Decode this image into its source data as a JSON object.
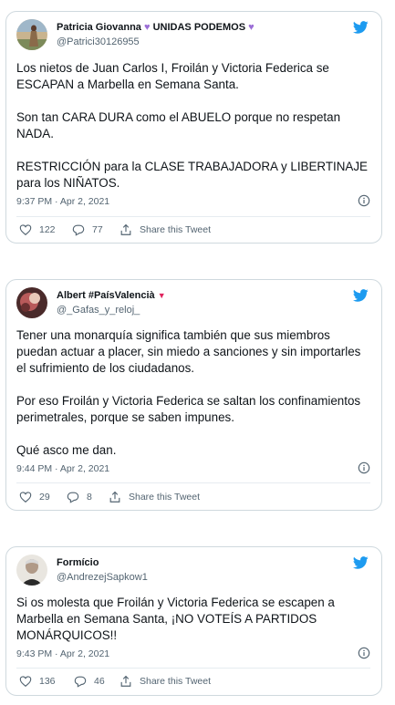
{
  "tweets": [
    {
      "name": "Patricia Giovanna",
      "name_suffix": "UNIDAS PODEMOS",
      "handle": "@Patrici30126955",
      "text": "Los nietos de Juan Carlos I, Froilán y Victoria Federica se ESCAPAN a Marbella en Semana Santa.\n\nSon tan CARA DURA como el ABUELO porque no respetan NADA.\n\nRESTRICCIÓN para la CLASE TRABAJADORA y LIBERTINAJE para los NIÑATOS.",
      "timestamp": "9:37 PM · Apr 2, 2021",
      "likes": "122",
      "replies": "77",
      "share_label": "Share this Tweet",
      "avatar_icon": "person-photo-avatar",
      "heart_color": "#9b6ed6"
    },
    {
      "name": "Albert #PaísValencià",
      "name_suffix": "",
      "handle": "@_Gafas_y_reloj_",
      "text": "Tener una monarquía significa también que sus miembros puedan actuar a placer, sin miedo a sanciones y sin importarles el sufrimiento de los ciudadanos.\n\nPor eso Froilán y Victoria Federica se saltan los confinamientos perimetrales, porque se saben impunes.\n\nQué asco me dan.",
      "timestamp": "9:44 PM · Apr 2, 2021",
      "likes": "29",
      "replies": "8",
      "share_label": "Share this Tweet",
      "avatar_icon": "flower-photo-avatar",
      "flag_color": "#e0245e"
    },
    {
      "name": "Formício",
      "name_suffix": "",
      "handle": "@AndrezejSapkow1",
      "text": "Si os molesta que Froilán y Victoria Federica se escapen a Marbella en Semana Santa, ¡NO VOTEÍS A PARTIDOS MONÁRQUICOS!!",
      "timestamp": "9:43 PM · Apr 2, 2021",
      "likes": "136",
      "replies": "46",
      "share_label": "Share this Tweet",
      "avatar_icon": "man-portrait-avatar"
    }
  ],
  "colors": {
    "twitter_blue": "#1d9bf0",
    "muted_text": "#536471",
    "border": "#cfd9de"
  },
  "icons": [
    "twitter-bird-icon",
    "info-icon",
    "heart-icon",
    "reply-icon",
    "share-icon"
  ]
}
